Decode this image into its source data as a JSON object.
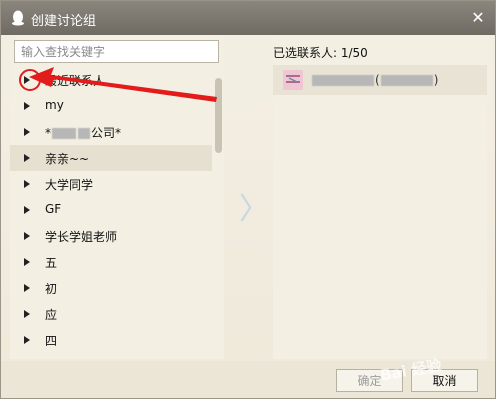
{
  "window": {
    "title": "创建讨论组",
    "close_glyph": "✕"
  },
  "search": {
    "placeholder": "输入查找关键字"
  },
  "groups": [
    {
      "label": "最近联系人"
    },
    {
      "label": "my"
    },
    {
      "label_suffix": "公司*",
      "label_prefix": "*"
    },
    {
      "label": "亲亲~~"
    },
    {
      "label": "大学同学"
    },
    {
      "label": "GF"
    },
    {
      "label": "学长学姐老师"
    },
    {
      "label": "五"
    },
    {
      "label": "初"
    },
    {
      "label": "应"
    },
    {
      "label": "四"
    }
  ],
  "middle": {
    "arrow_glyph": "〉"
  },
  "selected": {
    "label": "已选联系人: 1/50",
    "contact_name_visible": "(",
    "contact_name_end": ")"
  },
  "buttons": {
    "ok": "确定",
    "cancel": "取消"
  },
  "watermark": "Bai 经验",
  "colors": {
    "titlebar": "#7c7870",
    "panel": "#f3efe3",
    "annotation_red": "#e21b1b",
    "disabled_text": "#9d9d9d"
  },
  "icons": {
    "title": "qq-penguin-icon",
    "close": "close-icon",
    "expand": "triangle-right-icon",
    "transfer": "chevron-right-icon"
  }
}
